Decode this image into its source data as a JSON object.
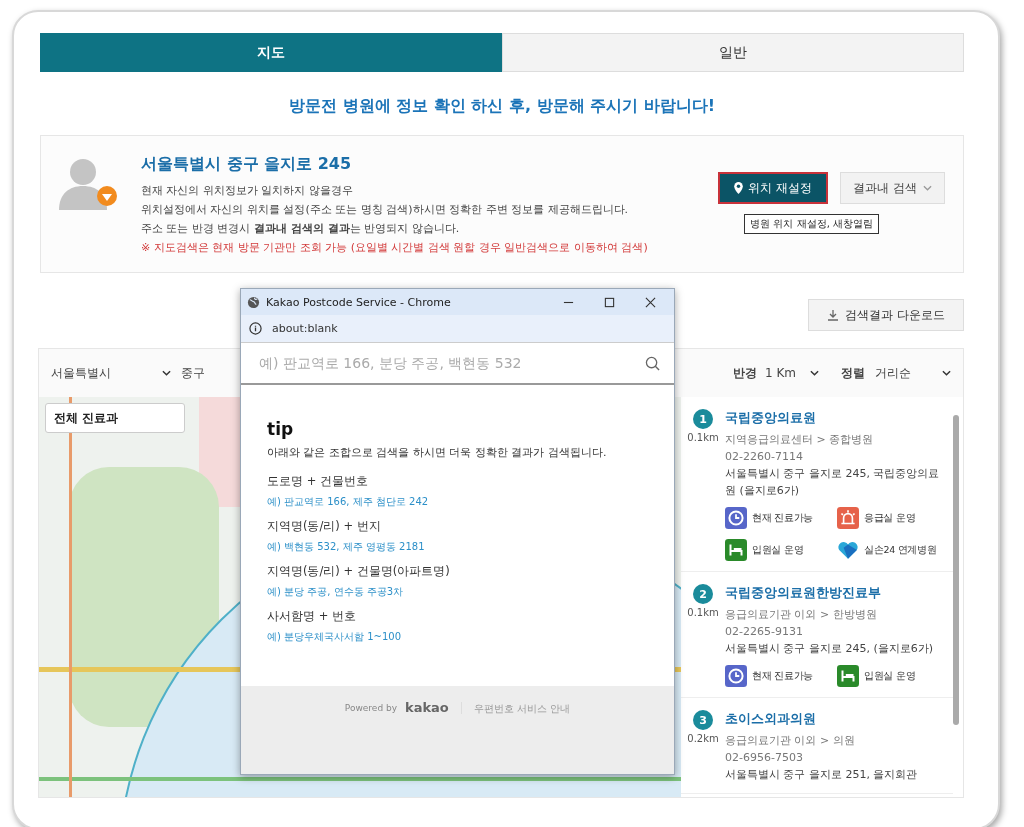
{
  "tabs": [
    {
      "label": "지도",
      "selected": true
    },
    {
      "label": "일반",
      "selected": false
    }
  ],
  "notice": "방문전 병원에 정보 확인 하신 후, 방문해 주시기 바랍니다!",
  "location": {
    "address": "서울특별시 중구 을지로 245",
    "lines": [
      "현재 자신의 위치정보가 일치하지 않을경우",
      "위치설정에서 자신의 위치를 설정(주소 또는 명칭 검색)하시면 정확한 주변 정보를 제공해드립니다.",
      "주소 또는 반경 변경시 **결과내 검색의 결과**는 반영되지 않습니다."
    ],
    "warning": "※ 지도검색은 현재 방문 기관만 조회 가능 (요일별 시간별 검색 원할 경우 일반검색으로 이동하여 검색)",
    "reset_button": "위치 재설정",
    "search_button": "결과내 검색",
    "tooltip": "병원 위치 재설정, 새창열림"
  },
  "download_button": "검색결과 다운로드",
  "filters": {
    "city": "서울특별시",
    "district": "중구",
    "radius_label": "반경",
    "radius": "1 Km",
    "sort_label": "정렬",
    "sort": "거리순"
  },
  "map": {
    "department_button": "전체 진료과"
  },
  "results": [
    {
      "number": "1",
      "distance": "0.1km",
      "name": "국립중앙의료원",
      "category": "지역응급의료센터 > 종합병원",
      "phone": "02-2260-7114",
      "address": "서울특별시 중구 을지로 245, 국립중앙의료원 (을지로6가)",
      "badges": [
        {
          "kind": "clock",
          "label": "현재 진료가능"
        },
        {
          "kind": "emergency",
          "label": "응급실 운영"
        },
        {
          "kind": "bed",
          "label": "입원실 운영"
        },
        {
          "kind": "heart",
          "label": "실손24 연계병원"
        }
      ]
    },
    {
      "number": "2",
      "distance": "0.1km",
      "name": "국립중앙의료원한방진료부",
      "category": "응급의료기관 이외 > 한방병원",
      "phone": "02-2265-9131",
      "address": "서울특별시 중구 을지로 245, (을지로6가)",
      "badges": [
        {
          "kind": "clock",
          "label": "현재 진료가능"
        },
        {
          "kind": "bed",
          "label": "입원실 운영"
        }
      ]
    },
    {
      "number": "3",
      "distance": "0.2km",
      "name": "초이스외과의원",
      "category": "응급의료기관 이외 > 의원",
      "phone": "02-6956-7503",
      "address": "서울특별시 중구 을지로 251, 을지회관"
    }
  ],
  "popup": {
    "title": "Kakao Postcode Service - Chrome",
    "url": "about:blank",
    "search_placeholder": "예) 판교역로 166, 분당 주공, 백현동 532",
    "tip_title": "tip",
    "tip_intro": "아래와 같은 조합으로 검색을 하시면 더욱 정확한 결과가 검색됩니다.",
    "tips": [
      {
        "label": "도로명 + 건물번호",
        "example": "예) 판교역로 166,  제주 첨단로 242"
      },
      {
        "label": "지역명(동/리) + 번지",
        "example": "예) 백현동 532,  제주 영평동 2181"
      },
      {
        "label": "지역명(동/리) + 건물명(아파트명)",
        "example": "예) 분당 주공,  연수동 주공3차"
      },
      {
        "label": "사서함명 + 번호",
        "example": "예) 분당우체국사서함 1~100"
      }
    ],
    "powered_by": "Powered by",
    "brand": "kakao",
    "service_info": "우편번호 서비스 안내"
  }
}
